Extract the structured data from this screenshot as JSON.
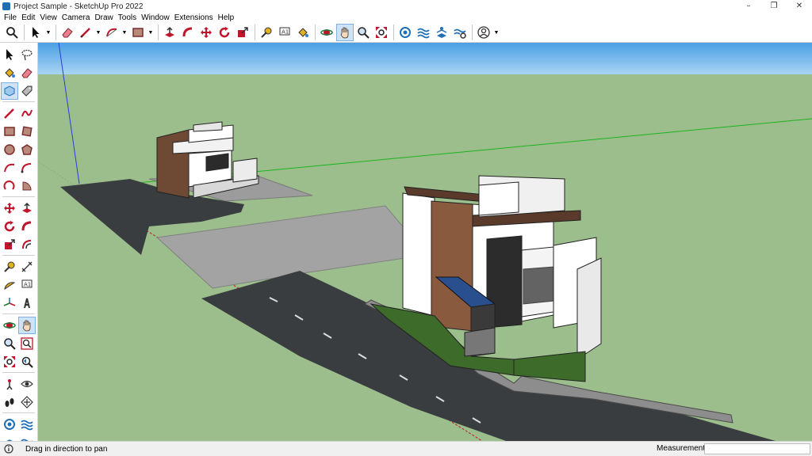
{
  "window": {
    "title": "Project Sample - SketchUp Pro 2022",
    "minimize": "–",
    "maximize": "❐",
    "close": "✕"
  },
  "menu": [
    "File",
    "Edit",
    "View",
    "Camera",
    "Draw",
    "Tools",
    "Window",
    "Extensions",
    "Help"
  ],
  "toolbar_icons": [
    "search-icon",
    "select-arrow-icon",
    "eraser-icon",
    "pencil-line-icon",
    "arc-icon",
    "rectangle-icon",
    "push-pull-icon",
    "follow-me-icon",
    "move-icon",
    "rotate-icon",
    "scale-icon",
    "tape-measure-icon",
    "text-icon",
    "paint-bucket-icon",
    "orbit-icon",
    "pan-icon",
    "zoom-icon",
    "zoom-extents-icon",
    "3d-warehouse-icon",
    "extension-warehouse-icon",
    "layout-icon",
    "extension-manager-icon",
    "user-account-icon"
  ],
  "statusbar": {
    "hint": "Drag in direction to pan",
    "measurements_label": "Measurements",
    "measurements_value": ""
  },
  "colors": {
    "sky": "#5aa9e6",
    "ground": "#9cbe8c",
    "road": "#3a3d40",
    "active_tool": "#cfe3f7"
  }
}
